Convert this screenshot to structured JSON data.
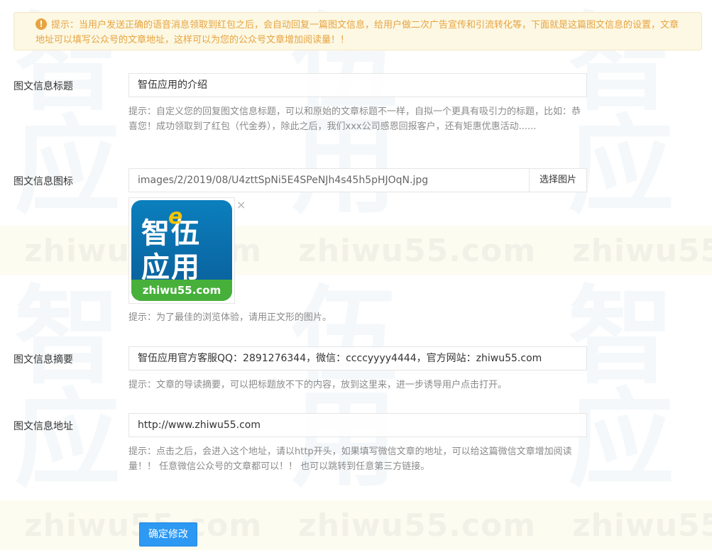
{
  "notice": {
    "icon": "exclamation-icon",
    "text": "提示：当用户发送正确的语音消息领取到红包之后，会自动回复一篇图文信息，给用户做二次广告宣传和引流转化等，下面就是这篇图文信息的设置，文章地址可以填写公众号的文章地址，这样可以为您的公众号文章增加阅读量！！"
  },
  "watermark": {
    "glyph_1": "智",
    "glyph_2": "伍",
    "glyph_3": "应",
    "glyph_4": "用",
    "text": "zhiwu55.com",
    "icon": "zhiwu-logo-watermark"
  },
  "form": {
    "title_label": "图文信息标题",
    "title_value": "智伍应用的介绍",
    "title_hint": "提示：自定义您的回复图文信息标题，可以和原始的文章标题不一样，自拟一个更具有吸引力的标题，比如：恭喜您！成功领取到了红包（代金券），除此之后，我们xxx公司感恩回报客户，还有矩惠优惠活动......",
    "icon_label": "图文信息图标",
    "icon_value": "images/2/2019/08/U4zttSpNi5E4SPeNJh4s45h5pHJOqN.jpg",
    "pick_button": "选择图片",
    "logo_text_1": "智伍",
    "logo_text_2": "应用",
    "logo_e": "e",
    "logo_domain": "zhiwu55.com",
    "close_icon": "×",
    "icon_hint": "提示：为了最佳的浏览体验，请用正文形的图片。",
    "summary_label": "图文信息摘要",
    "summary_value": "智伍应用官方客服QQ：2891276344，微信：ccccyyyy4444，官方网站：zhiwu55.com",
    "summary_hint": "提示：文章的导读摘要，可以把标题放不下的内容，放到这里来，进一步诱导用户点击打开。",
    "url_label": "图文信息地址",
    "url_value": "http://www.zhiwu55.com",
    "url_hint": "提示：点击之后，会进入这个地址，请以http开头，如果填写微信文章的地址，可以给这篇微信文章增加阅读量！！ 任意微信公众号的文章都可以！！ 也可以跳转到任意第三方链接。",
    "submit_button": "确定修改"
  },
  "colors": {
    "notice_text": "#e8a341",
    "notice_bg": "#fcf8e3",
    "primary": "#2d99f3",
    "hint": "#8a8a8a"
  }
}
